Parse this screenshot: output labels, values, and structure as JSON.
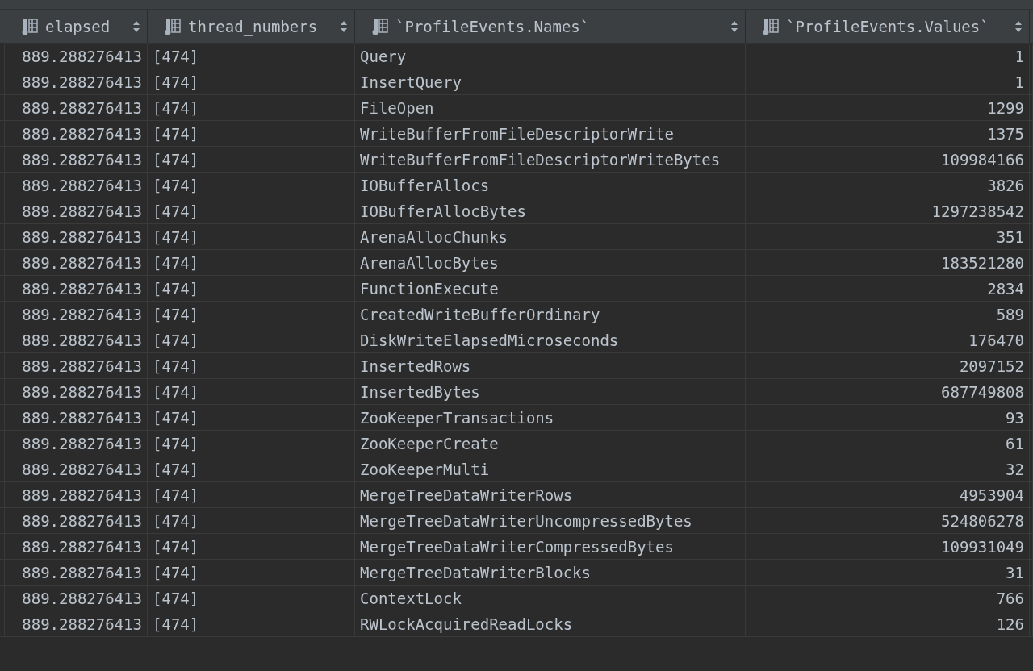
{
  "table": {
    "columns": [
      {
        "label": "elapsed",
        "kind": "number"
      },
      {
        "label": "thread_numbers",
        "kind": "text"
      },
      {
        "label": "`ProfileEvents.Names`",
        "kind": "text"
      },
      {
        "label": "`ProfileEvents.Values`",
        "kind": "number"
      }
    ],
    "rows": [
      [
        "889.288276413",
        "[474]",
        "Query",
        "1"
      ],
      [
        "889.288276413",
        "[474]",
        "InsertQuery",
        "1"
      ],
      [
        "889.288276413",
        "[474]",
        "FileOpen",
        "1299"
      ],
      [
        "889.288276413",
        "[474]",
        "WriteBufferFromFileDescriptorWrite",
        "1375"
      ],
      [
        "889.288276413",
        "[474]",
        "WriteBufferFromFileDescriptorWriteBytes",
        "109984166"
      ],
      [
        "889.288276413",
        "[474]",
        "IOBufferAllocs",
        "3826"
      ],
      [
        "889.288276413",
        "[474]",
        "IOBufferAllocBytes",
        "1297238542"
      ],
      [
        "889.288276413",
        "[474]",
        "ArenaAllocChunks",
        "351"
      ],
      [
        "889.288276413",
        "[474]",
        "ArenaAllocBytes",
        "183521280"
      ],
      [
        "889.288276413",
        "[474]",
        "FunctionExecute",
        "2834"
      ],
      [
        "889.288276413",
        "[474]",
        "CreatedWriteBufferOrdinary",
        "589"
      ],
      [
        "889.288276413",
        "[474]",
        "DiskWriteElapsedMicroseconds",
        "176470"
      ],
      [
        "889.288276413",
        "[474]",
        "InsertedRows",
        "2097152"
      ],
      [
        "889.288276413",
        "[474]",
        "InsertedBytes",
        "687749808"
      ],
      [
        "889.288276413",
        "[474]",
        "ZooKeeperTransactions",
        "93"
      ],
      [
        "889.288276413",
        "[474]",
        "ZooKeeperCreate",
        "61"
      ],
      [
        "889.288276413",
        "[474]",
        "ZooKeeperMulti",
        "32"
      ],
      [
        "889.288276413",
        "[474]",
        "MergeTreeDataWriterRows",
        "4953904"
      ],
      [
        "889.288276413",
        "[474]",
        "MergeTreeDataWriterUncompressedBytes",
        "524806278"
      ],
      [
        "889.288276413",
        "[474]",
        "MergeTreeDataWriterCompressedBytes",
        "109931049"
      ],
      [
        "889.288276413",
        "[474]",
        "MergeTreeDataWriterBlocks",
        "31"
      ],
      [
        "889.288276413",
        "[474]",
        "ContextLock",
        "766"
      ],
      [
        "889.288276413",
        "[474]",
        "RWLockAcquiredReadLocks",
        "126"
      ]
    ]
  }
}
